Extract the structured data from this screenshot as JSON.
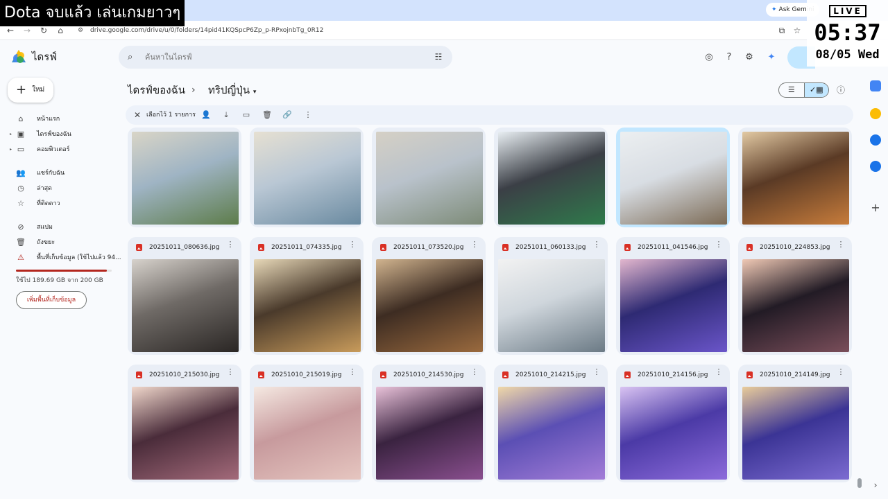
{
  "overlay": {
    "title": "Dota จบแล้ว เล่นเกมยาวๆ",
    "live": "LIVE",
    "time": "05:37",
    "date": "08/05 Wed"
  },
  "browser": {
    "ask_gemini": "Ask Gemini",
    "url": "drive.google.com/drive/u/0/folders/14pid41KQSpcP6Zp_p-RPxojnbTg_0R12"
  },
  "drive": {
    "brand": "ไดรฟ์",
    "search_placeholder": "ค้นหาในไดรฟ์",
    "new_label": "ใหม่",
    "sidebar": {
      "home": "หน้าแรก",
      "my_drive": "ไดรฟ์ของฉัน",
      "computers": "คอมพิวเตอร์",
      "shared": "แชร์กับฉัน",
      "recent": "ล่าสุด",
      "starred": "ที่ติดดาว",
      "spam": "สแปม",
      "trash": "ถังขยะ",
      "storage": "พื้นที่เก็บข้อมูล (ใช้ไปแล้ว 94..."
    },
    "storage": {
      "used_fraction": 0.9485,
      "text": "ใช้ไป 189.69 GB จาก 200 GB",
      "button": "เพิ่มพื้นที่เก็บข้อมูล"
    },
    "breadcrumb": {
      "root": "ไดรฟ์ของฉัน",
      "separator": "›",
      "current": "ทริปญี่ปุ่น"
    },
    "selection": {
      "count": "เลือกไว้ 1 รายการ"
    },
    "files_row1": [
      {
        "name": "",
        "icon": "image-thumbnail"
      },
      {
        "name": "",
        "icon": "image-thumbnail"
      },
      {
        "name": "",
        "icon": "image-thumbnail"
      },
      {
        "name": "",
        "icon": "image-thumbnail"
      },
      {
        "name": "",
        "icon": "image-thumbnail"
      },
      {
        "name": "",
        "icon": "image-thumbnail"
      }
    ],
    "files_row2": [
      {
        "name": "20251011_080636.jpg"
      },
      {
        "name": "20251011_074335.jpg"
      },
      {
        "name": "20251011_073520.jpg"
      },
      {
        "name": "20251011_060133.jpg"
      },
      {
        "name": "20251011_041546.jpg"
      },
      {
        "name": "20251010_224853.jpg"
      }
    ],
    "files_row3": [
      {
        "name": "20251010_215030.jpg"
      },
      {
        "name": "20251010_215019.jpg"
      },
      {
        "name": "20251010_214530.jpg"
      },
      {
        "name": "20251010_214215.jpg"
      },
      {
        "name": "20251010_214156.jpg"
      },
      {
        "name": "20251010_214149.jpg"
      }
    ]
  },
  "colors": {
    "accent": "#c2e7ff",
    "warning": "#b3261e",
    "surface": "#e9eef6"
  }
}
